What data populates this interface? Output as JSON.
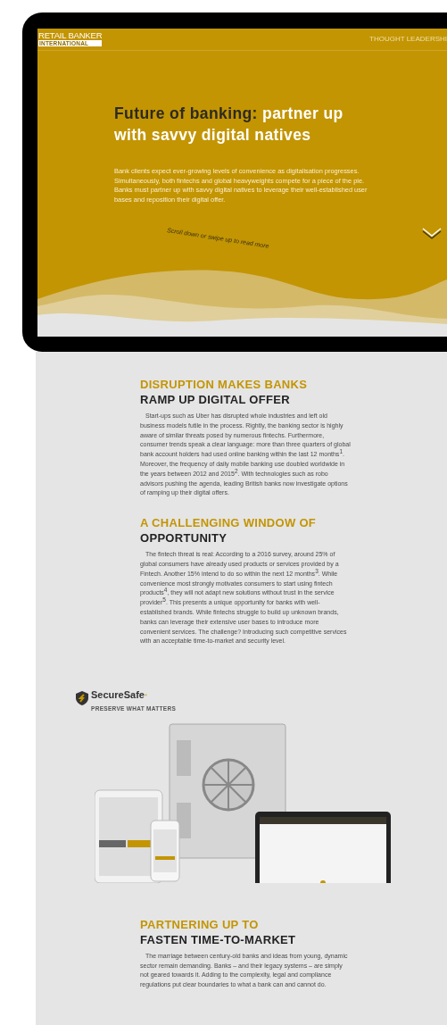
{
  "hero": {
    "logo_name": "RETAIL BANKER",
    "logo_tag": "INTERNATIONAL",
    "nav_link": "THOUGHT LEADERSHI",
    "title_lead": "Future of banking:",
    "title_rest": "partner up with savvy digital natives",
    "intro": "Bank clients expect ever-growing levels of convenience as digitalisation progresses. Simultaneously, both fintechs and global heavyweights compete for a piece of the pie. Banks must partner up with savvy digital natives to leverage their well-established user bases and reposition their digital offer.",
    "scroll_hint": "Scroll down or swipe up to read more"
  },
  "sections": [
    {
      "kind": "text",
      "heading_gold": "DISRUPTION MAKES BANKS",
      "heading_dark": "RAMP UP DIGITAL OFFER",
      "body": "Start-ups such as Uber has disrupted whole industries and left old business models futile in the process. Rightly, the banking sector is highly aware of similar threats posed by numerous fintechs. Furthermore, consumer trends speak a clear language: more than three quarters of global bank account holders had used online banking within the last 12 months$^{1}$. Moreover, the frequency of daily mobile banking use doubled worldwide in the years between 2012 and 2015$^{2}$. With technologies such as robo advisors pushing the agenda, leading British banks now investigate options of ramping up their digital offers."
    },
    {
      "kind": "text",
      "heading_gold": "A CHALLENGING WINDOW OF",
      "heading_dark": "OPPORTUNITY",
      "body": "The fintech threat is real: According to a 2016 survey, around 25% of global consumers have already used products or services provided by a Fintech. Another 15% intend to do so within the next 12 months$^{3}$. While convenience most strongly motivates consumers to start using fintech products$^{4}$, they will not adapt new solutions without trust in the service provider$^{5}$. This presents a unique opportunity for banks with well-established brands. While fintechs struggle to build up unknown brands, banks can leverage their extensive user bases to introduce more convenient services. The challenge? Introducing such competitive services with an acceptable time-to-market and security level."
    },
    {
      "kind": "showcase",
      "brand": "SecureSafe",
      "brand_mark": "®",
      "tagline": "PRESERVE WHAT MATTERS"
    },
    {
      "kind": "text",
      "heading_gold": "PARTNERING UP TO",
      "heading_dark": "FASTEN TIME-TO-MARKET",
      "body": "The marriage between century-old banks and ideas from young, dynamic sector remain demanding. Banks – and their legacy systems – are simply not geared towards it. Adding to the complexity, legal and compliance regulations put clear boundaries to what a bank can and cannot do."
    }
  ]
}
